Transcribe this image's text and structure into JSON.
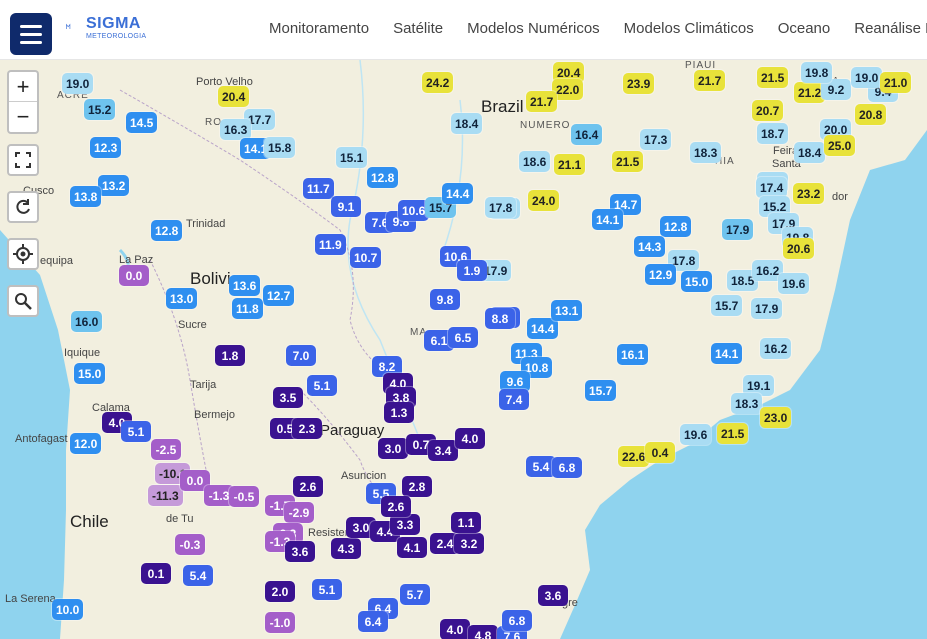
{
  "header": {
    "logo_text": "SIGMA",
    "logo_sub": "METEOROLOGIA",
    "nav": [
      "Monitoramento",
      "Satélite",
      "Modelos Numéricos",
      "Modelos Climáticos",
      "Oceano",
      "Reanálise ER"
    ]
  },
  "map_controls": {
    "zoom_in": "+",
    "zoom_out": "−"
  },
  "colors": {
    "ocean": "#8fd3ee",
    "land": "#f2efdf",
    "dark_purple": "#3a1290",
    "purple": "#5a2fc4",
    "violet": "#a45ec9",
    "light_violet": "#c59ad9",
    "blue": "#3b63e8",
    "mid_blue": "#2f8ff0",
    "light_blue": "#6ec3ee",
    "pale_blue": "#a9dcf3",
    "yellow": "#e8e23a"
  },
  "places": [
    {
      "text": "Brazil",
      "kind": "country"
    },
    {
      "text": "Bolivia",
      "kind": "country"
    },
    {
      "text": "Chile",
      "kind": "country"
    },
    {
      "text": "Paraguay",
      "kind": "country"
    },
    {
      "text": "ACRE",
      "kind": "state"
    },
    {
      "text": "RO",
      "kind": "state"
    },
    {
      "text": "Porto Velho",
      "kind": "city"
    },
    {
      "text": "Cusco",
      "kind": "city"
    },
    {
      "text": "Trinidad",
      "kind": "city"
    },
    {
      "text": "La Paz",
      "kind": "city"
    },
    {
      "text": "equipa",
      "kind": "city"
    },
    {
      "text": "Sucre",
      "kind": "city"
    },
    {
      "text": "Iquique",
      "kind": "city"
    },
    {
      "text": "Tarija",
      "kind": "city"
    },
    {
      "text": "Calama",
      "kind": "city"
    },
    {
      "text": "Bermejo",
      "kind": "city"
    },
    {
      "text": "Antofagast",
      "kind": "city"
    },
    {
      "text": "de Tu",
      "kind": "city"
    },
    {
      "text": "Resistencia",
      "kind": "city"
    },
    {
      "text": "Asuncion",
      "kind": "city"
    },
    {
      "text": "La Serena",
      "kind": "city"
    },
    {
      "text": "NUMERO",
      "kind": "state"
    },
    {
      "text": "PIAUI",
      "kind": "state"
    },
    {
      "text": "ALA",
      "kind": "state"
    },
    {
      "text": "HIA",
      "kind": "state"
    },
    {
      "text": "Feira",
      "kind": "city"
    },
    {
      "text": "Santa",
      "kind": "city"
    },
    {
      "text": "dor",
      "kind": "city"
    },
    {
      "text": "MA",
      "kind": "state"
    },
    {
      "text": "gre",
      "kind": "city"
    }
  ],
  "stations": [
    {
      "v": "19.0",
      "c": "pale"
    },
    {
      "v": "15.2",
      "c": "light"
    },
    {
      "v": "14.5",
      "c": "mid"
    },
    {
      "v": "12.3",
      "c": "mid"
    },
    {
      "v": "13.2",
      "c": "mid"
    },
    {
      "v": "13.8",
      "c": "mid"
    },
    {
      "v": "20.4",
      "c": "yellow"
    },
    {
      "v": "17.7",
      "c": "pale"
    },
    {
      "v": "16.3",
      "c": "pale"
    },
    {
      "v": "14.1",
      "c": "mid"
    },
    {
      "v": "15.8",
      "c": "pale"
    },
    {
      "v": "24.2",
      "c": "yellow"
    },
    {
      "v": "18.4",
      "c": "pale"
    },
    {
      "v": "15.1",
      "c": "pale"
    },
    {
      "v": "11.7",
      "c": "blue"
    },
    {
      "v": "12.8",
      "c": "mid"
    },
    {
      "v": "9.1",
      "c": "blue"
    },
    {
      "v": "7.6",
      "c": "blue"
    },
    {
      "v": "9.8",
      "c": "blue"
    },
    {
      "v": "10.6",
      "c": "blue"
    },
    {
      "v": "15.7",
      "c": "light"
    },
    {
      "v": "14.4",
      "c": "mid"
    },
    {
      "v": "12.8",
      "c": "mid"
    },
    {
      "v": "13.0",
      "c": "mid"
    },
    {
      "v": "13.6",
      "c": "mid"
    },
    {
      "v": "12.7",
      "c": "mid"
    },
    {
      "v": "11.8",
      "c": "mid"
    },
    {
      "v": "16.0",
      "c": "light"
    },
    {
      "v": "15.0",
      "c": "mid"
    },
    {
      "v": "12.0",
      "c": "mid"
    },
    {
      "v": "0.0",
      "c": "violet"
    },
    {
      "v": "11.9",
      "c": "blue"
    },
    {
      "v": "10.7",
      "c": "blue"
    },
    {
      "v": "10.6",
      "c": "blue"
    },
    {
      "v": "9.8",
      "c": "blue"
    },
    {
      "v": "6.1",
      "c": "blue"
    },
    {
      "v": "6.5",
      "c": "blue"
    },
    {
      "v": "8.8",
      "c": "blue"
    },
    {
      "v": "8.2",
      "c": "blue"
    },
    {
      "v": "7.0",
      "c": "blue"
    },
    {
      "v": "5.1",
      "c": "blue"
    },
    {
      "v": "3.5",
      "c": "dark"
    },
    {
      "v": "1.8",
      "c": "dark"
    },
    {
      "v": "4.0",
      "c": "dark"
    },
    {
      "v": "3.8",
      "c": "dark"
    },
    {
      "v": "1.3",
      "c": "dark"
    },
    {
      "v": "3.0",
      "c": "dark"
    },
    {
      "v": "0.7",
      "c": "dark"
    },
    {
      "v": "0.5",
      "c": "dark"
    },
    {
      "v": "2.3",
      "c": "dark"
    },
    {
      "v": "3.4",
      "c": "dark"
    },
    {
      "v": "4.0",
      "c": "dark"
    },
    {
      "v": "5.4",
      "c": "blue"
    },
    {
      "v": "6.8",
      "c": "blue"
    },
    {
      "v": "4.0",
      "c": "dark"
    },
    {
      "v": "5.1",
      "c": "blue"
    },
    {
      "v": "-2.5",
      "c": "violet"
    },
    {
      "v": "-10.1",
      "c": "lightviolet"
    },
    {
      "v": "-11.3",
      "c": "lightviolet"
    },
    {
      "v": "0.0",
      "c": "violet"
    },
    {
      "v": "-1.3",
      "c": "violet"
    },
    {
      "v": "-0.5",
      "c": "violet"
    },
    {
      "v": "-1.7",
      "c": "violet"
    },
    {
      "v": "-2.9",
      "c": "violet"
    },
    {
      "v": "0.3",
      "c": "violet"
    },
    {
      "v": "-1.3",
      "c": "violet"
    },
    {
      "v": "-0.3",
      "c": "violet"
    },
    {
      "v": "3.6",
      "c": "dark"
    },
    {
      "v": "4.3",
      "c": "dark"
    },
    {
      "v": "5.4",
      "c": "blue"
    },
    {
      "v": "0.1",
      "c": "dark"
    },
    {
      "v": "2.6",
      "c": "dark"
    },
    {
      "v": "3.0",
      "c": "dark"
    },
    {
      "v": "4.4",
      "c": "dark"
    },
    {
      "v": "4.1",
      "c": "dark"
    },
    {
      "v": "2.8",
      "c": "dark"
    },
    {
      "v": "3.3",
      "c": "dark"
    },
    {
      "v": "2.4",
      "c": "dark"
    },
    {
      "v": "3.2",
      "c": "dark"
    },
    {
      "v": "1.1",
      "c": "dark"
    },
    {
      "v": "5.5",
      "c": "blue"
    },
    {
      "v": "2.6",
      "c": "dark"
    },
    {
      "v": "2.0",
      "c": "dark"
    },
    {
      "v": "-1.0",
      "c": "violet"
    },
    {
      "v": "5.1",
      "c": "blue"
    },
    {
      "v": "6.4",
      "c": "blue"
    },
    {
      "v": "6.4",
      "c": "blue"
    },
    {
      "v": "5.7",
      "c": "blue"
    },
    {
      "v": "4.0",
      "c": "dark"
    },
    {
      "v": "4.8",
      "c": "dark"
    },
    {
      "v": "7.6",
      "c": "blue"
    },
    {
      "v": "6.8",
      "c": "blue"
    },
    {
      "v": "3.6",
      "c": "dark"
    },
    {
      "v": "10.0",
      "c": "mid"
    },
    {
      "v": "20.4",
      "c": "yellow"
    },
    {
      "v": "22.0",
      "c": "yellow"
    },
    {
      "v": "21.7",
      "c": "yellow"
    },
    {
      "v": "23.9",
      "c": "yellow"
    },
    {
      "v": "21.7",
      "c": "yellow"
    },
    {
      "v": "21.5",
      "c": "yellow"
    },
    {
      "v": "21.2",
      "c": "yellow"
    },
    {
      "v": "9.2",
      "c": "pale"
    },
    {
      "v": "9.4",
      "c": "pale"
    },
    {
      "v": "19.0",
      "c": "pale"
    },
    {
      "v": "21.0",
      "c": "yellow"
    },
    {
      "v": "20.7",
      "c": "yellow"
    },
    {
      "v": "20.8",
      "c": "yellow"
    },
    {
      "v": "19.8",
      "c": "pale"
    },
    {
      "v": "16.4",
      "c": "light"
    },
    {
      "v": "17.3",
      "c": "pale"
    },
    {
      "v": "18.6",
      "c": "pale"
    },
    {
      "v": "21.1",
      "c": "yellow"
    },
    {
      "v": "21.5",
      "c": "yellow"
    },
    {
      "v": "18.3",
      "c": "pale"
    },
    {
      "v": "18.7",
      "c": "pale"
    },
    {
      "v": "20.0",
      "c": "pale"
    },
    {
      "v": "18.4",
      "c": "pale"
    },
    {
      "v": "25.0",
      "c": "yellow"
    },
    {
      "v": "17.8",
      "c": "pale"
    },
    {
      "v": "24.0",
      "c": "yellow"
    },
    {
      "v": "17.8",
      "c": "pale"
    },
    {
      "v": "14.7",
      "c": "mid"
    },
    {
      "v": "14.1",
      "c": "mid"
    },
    {
      "v": "12.8",
      "c": "mid"
    },
    {
      "v": "18.7",
      "c": "pale"
    },
    {
      "v": "17.4",
      "c": "pale"
    },
    {
      "v": "23.2",
      "c": "yellow"
    },
    {
      "v": "15.2",
      "c": "pale"
    },
    {
      "v": "17.9",
      "c": "pale"
    },
    {
      "v": "19.8",
      "c": "pale"
    },
    {
      "v": "20.6",
      "c": "yellow"
    },
    {
      "v": "17.9",
      "c": "light"
    },
    {
      "v": "14.3",
      "c": "mid"
    },
    {
      "v": "17.8",
      "c": "pale"
    },
    {
      "v": "12.9",
      "c": "mid"
    },
    {
      "v": "18.5",
      "c": "pale"
    },
    {
      "v": "16.2",
      "c": "pale"
    },
    {
      "v": "19.6",
      "c": "pale"
    },
    {
      "v": "15.0",
      "c": "mid"
    },
    {
      "v": "15.7",
      "c": "pale"
    },
    {
      "v": "17.9",
      "c": "pale"
    },
    {
      "v": "16.2",
      "c": "pale"
    },
    {
      "v": "14.1",
      "c": "mid"
    },
    {
      "v": "16.1",
      "c": "mid"
    },
    {
      "v": "19.1",
      "c": "pale"
    },
    {
      "v": "18.3",
      "c": "pale"
    },
    {
      "v": "23.0",
      "c": "yellow"
    },
    {
      "v": "11.3",
      "c": "mid"
    },
    {
      "v": "14.4",
      "c": "mid"
    },
    {
      "v": "13.1",
      "c": "mid"
    },
    {
      "v": "10.8",
      "c": "mid"
    },
    {
      "v": "9.6",
      "c": "mid"
    },
    {
      "v": "7.4",
      "c": "blue"
    },
    {
      "v": "15.7",
      "c": "mid"
    },
    {
      "v": "19.6",
      "c": "pale"
    },
    {
      "v": "21.5",
      "c": "yellow"
    },
    {
      "v": "22.6",
      "c": "yellow"
    },
    {
      "v": "0.4",
      "c": "yellow"
    },
    {
      "v": "17.9",
      "c": "pale"
    },
    {
      "v": "1.9",
      "c": "blue"
    },
    {
      "v": "8.8",
      "c": "blue"
    }
  ]
}
